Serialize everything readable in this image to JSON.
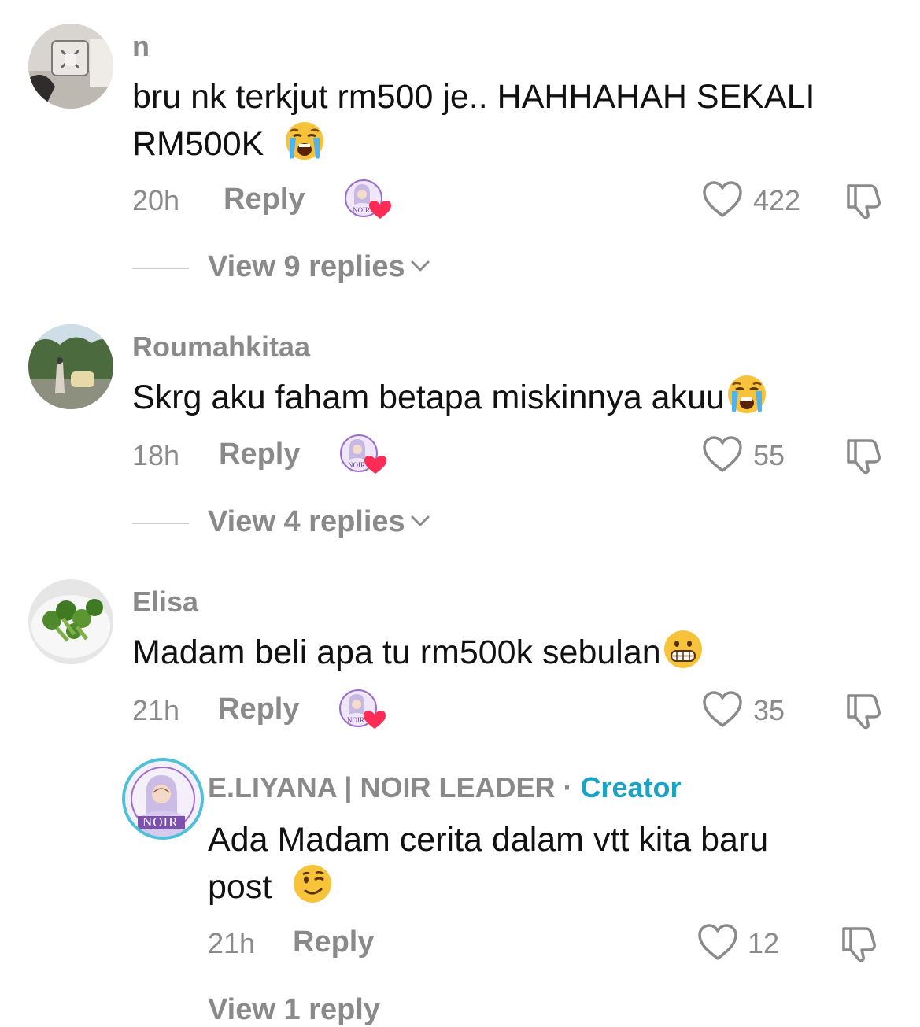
{
  "comments": [
    {
      "username": "n",
      "text_line1": "bru nk terkjut rm500 je.. HAHHAHAH SEKALI",
      "text_line2": "RM500K",
      "time": "20h",
      "reply_label": "Reply",
      "likes": "422",
      "view_replies": "View 9 replies",
      "emoji": "loudly-crying-face"
    },
    {
      "username": "Roumahkitaa",
      "text_line1": "Skrg aku faham betapa miskinnya akuu",
      "time": "18h",
      "reply_label": "Reply",
      "likes": "55",
      "view_replies": "View 4 replies",
      "emoji": "loudly-crying-face"
    },
    {
      "username": "Elisa",
      "text_line1": "Madam beli apa tu rm500k sebulan",
      "time": "21h",
      "reply_label": "Reply",
      "likes": "35",
      "emoji": "grimacing-face"
    }
  ],
  "creator_reply": {
    "username": "E.LIYANA | NOIR LEADER",
    "separator": "·",
    "creator_label": "Creator",
    "text_line1": "Ada Madam cerita dalam vtt kita baru",
    "text_line2": "post",
    "time": "21h",
    "reply_label": "Reply",
    "likes": "12",
    "emoji": "winking-face",
    "avatar_text": "NOIR",
    "next_partial": "View 1 reply"
  },
  "colors": {
    "muted": "#8a8a8a",
    "creator": "#1aa3c4",
    "heart": "#fe2c55"
  }
}
